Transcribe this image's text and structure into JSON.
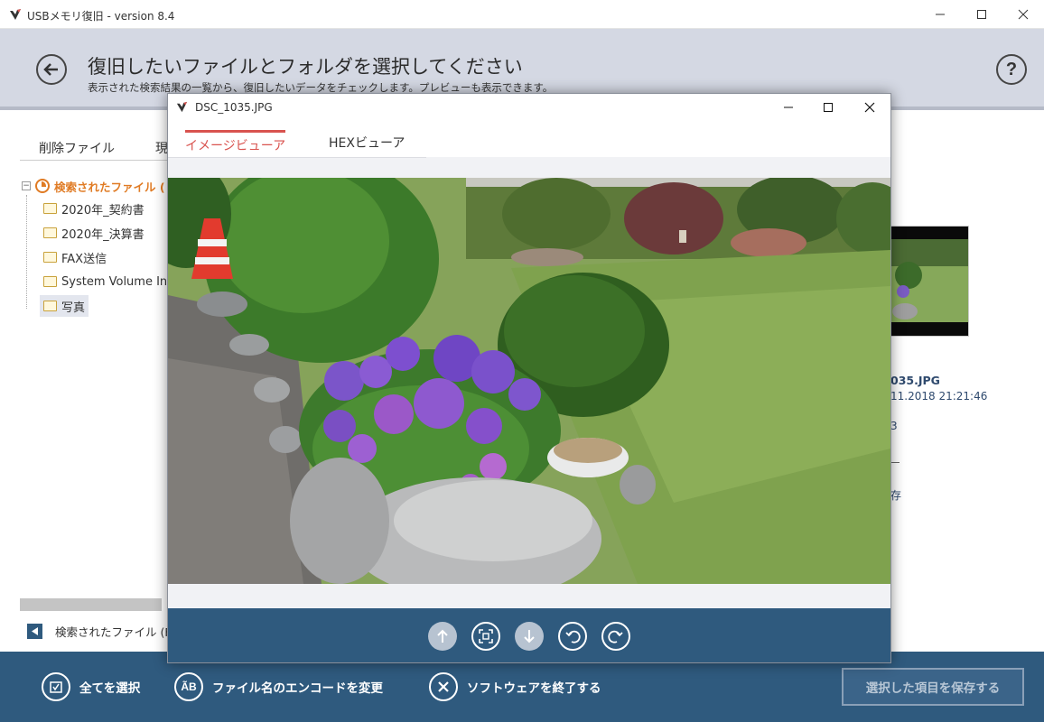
{
  "window": {
    "title": "USBメモリ復旧 - version 8.4"
  },
  "header": {
    "title": "復旧したいファイルとフォルダを選択してください",
    "subtitle": "表示された検索結果の一覧から、復旧したいデータをチェックします。プレビューも表示できます。"
  },
  "left_panel": {
    "tabs": [
      "削除ファイル",
      "現"
    ],
    "tree": {
      "root_label": "検索されたファイル (",
      "items": [
        {
          "label": "2020年_契約書",
          "selected": false
        },
        {
          "label": "2020年_決算書",
          "selected": false
        },
        {
          "label": "FAX送信",
          "selected": false
        },
        {
          "label": "System Volume Info",
          "selected": false
        },
        {
          "label": "写真",
          "selected": true
        }
      ]
    },
    "breadcrumb": "検索されたファイル (FA"
  },
  "preview_info": {
    "file_name": "035.JPG",
    "date": "11.2018 21:21:46",
    "mark1": "3",
    "mark2": "存"
  },
  "bottom_bar": {
    "select_all": "全てを選択",
    "change_encoding": "ファイル名のエンコードを変更",
    "encoding_icon_text": "ÃB",
    "exit": "ソフトウェアを終了する",
    "save_selected": "選択した項目を保存する"
  },
  "dialog": {
    "title": "DSC_1035.JPG",
    "tabs": [
      {
        "label": "イメージビューア",
        "active": true
      },
      {
        "label": "HEXビューア",
        "active": false
      }
    ],
    "toolbar": [
      "arrow-up-icon",
      "fit-screen-icon",
      "arrow-down-icon",
      "rotate-left-icon",
      "rotate-right-icon"
    ]
  },
  "colors": {
    "header_bg": "#d4d8e3",
    "accent_orange": "#e07b24",
    "bottom_bar_bg": "#2f5a7e",
    "active_tab": "#d9534f"
  }
}
